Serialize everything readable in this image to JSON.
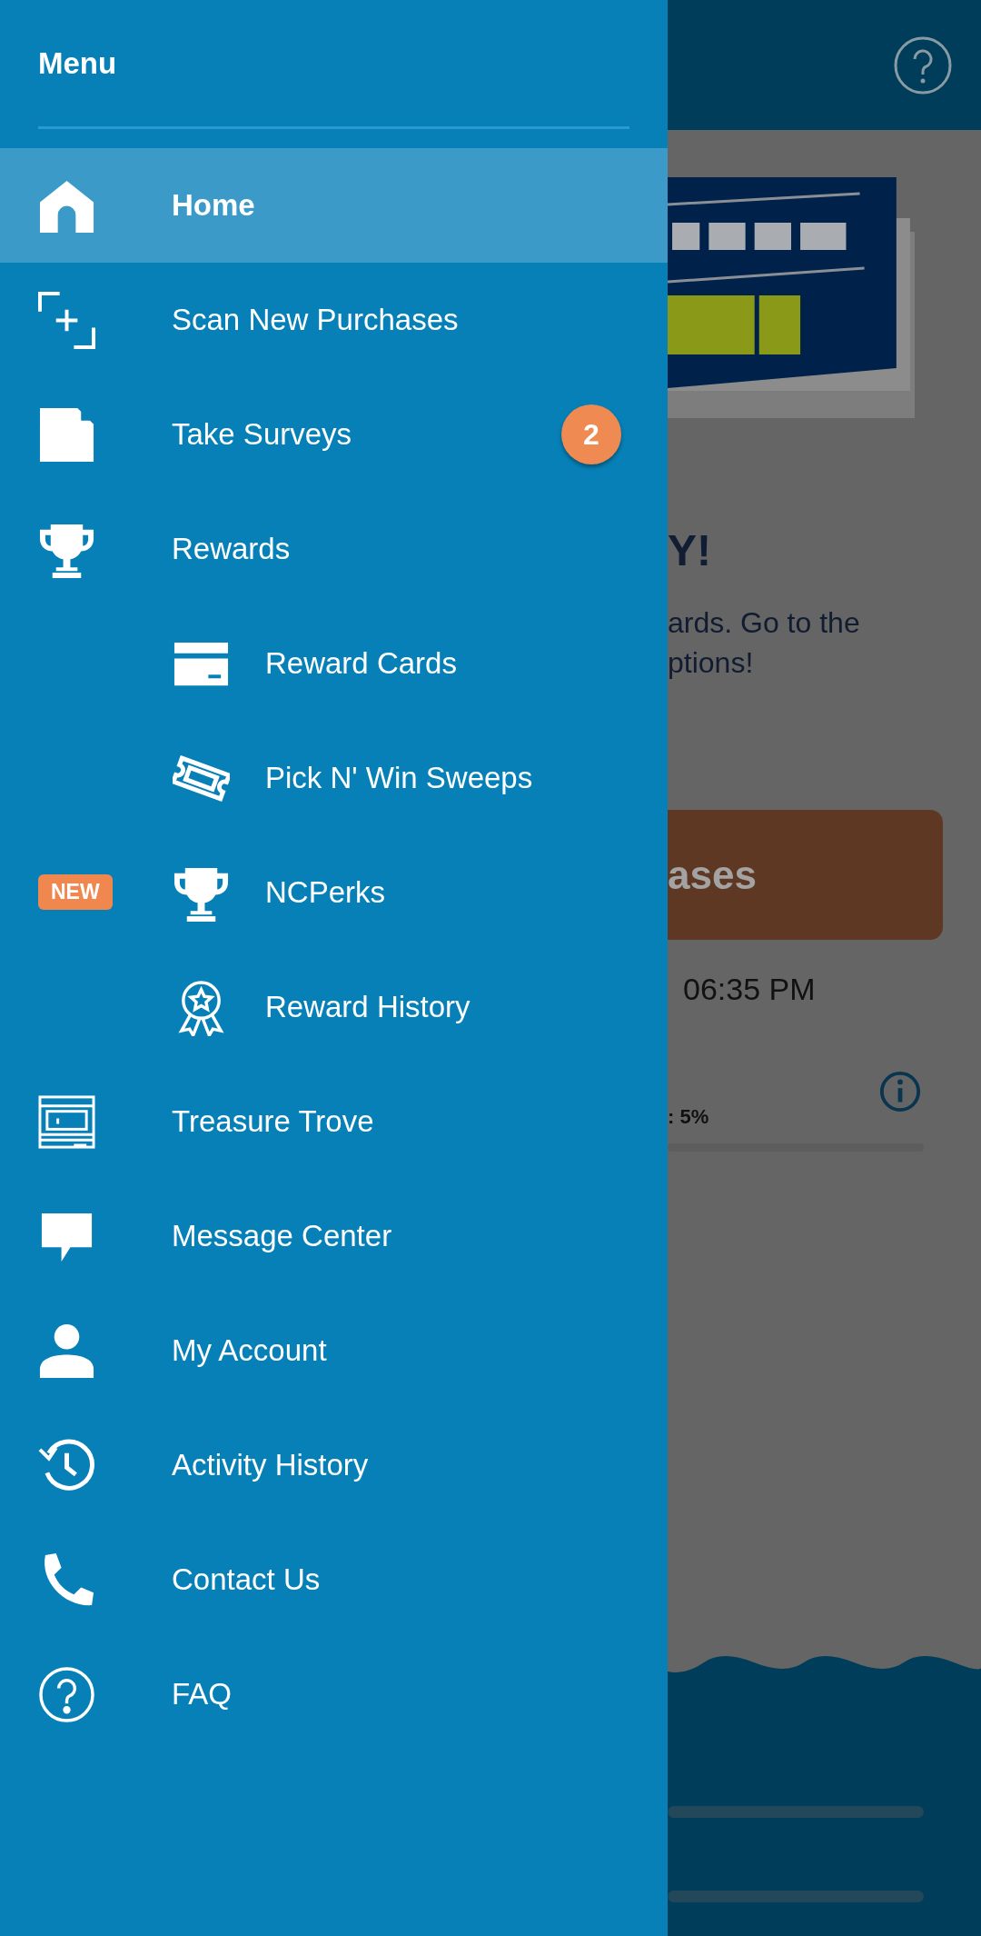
{
  "menu": {
    "title": "Menu",
    "items": [
      {
        "label": "Home",
        "selected": true
      },
      {
        "label": "Scan New Purchases",
        "selected": false
      },
      {
        "label": "Take Surveys",
        "selected": false,
        "badge": "2"
      },
      {
        "label": "Rewards",
        "selected": false,
        "children": [
          {
            "label": "Reward Cards",
            "selected": false
          },
          {
            "label": "Pick N' Win Sweeps",
            "selected": false
          },
          {
            "label": "NCPerks",
            "selected": false,
            "tag": "NEW"
          },
          {
            "label": "Reward History",
            "selected": false
          }
        ]
      },
      {
        "label": "Treasure Trove",
        "selected": false
      },
      {
        "label": "Message Center",
        "selected": false
      },
      {
        "label": "My Account",
        "selected": false
      },
      {
        "label": "Activity History",
        "selected": false
      },
      {
        "label": "Contact Us",
        "selected": false
      },
      {
        "label": "FAQ",
        "selected": false
      }
    ]
  },
  "background": {
    "heading": "Y!",
    "text_lines": [
      "ards. Go to the",
      "ptions!"
    ],
    "button": "ases",
    "time": "06:35 PM",
    "progress_label": ": 5%"
  }
}
